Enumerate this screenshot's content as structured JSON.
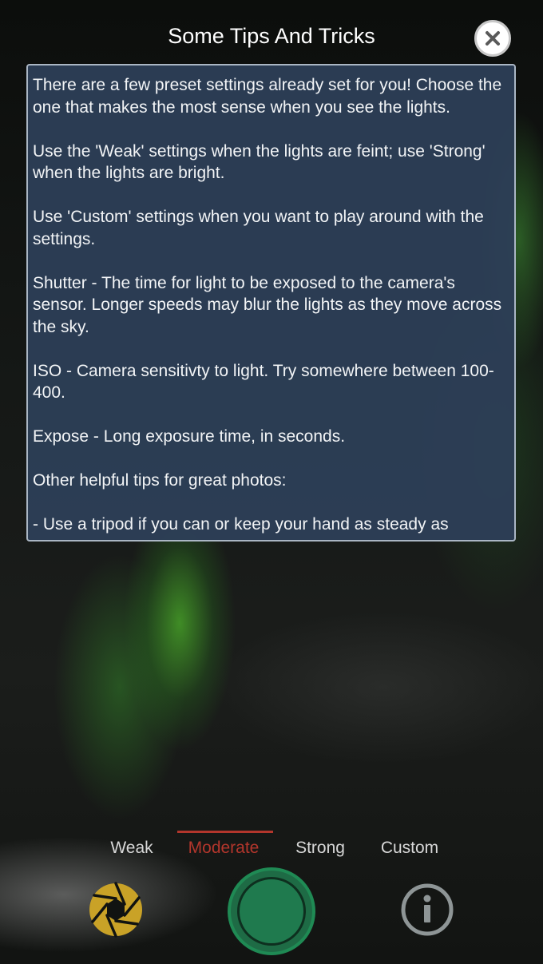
{
  "header": {
    "title": "Some Tips And Tricks"
  },
  "panel": {
    "paragraphs": [
      "There are a few preset settings already set for you! Choose the one that makes the most sense when you see the lights.",
      "Use the 'Weak' settings when the lights are feint; use 'Strong' when the lights are bright.",
      "Use 'Custom' settings when you want to play around with the settings.",
      "Shutter - The time for light to be exposed to the camera's sensor. Longer speeds may blur the lights as they move across the sky.",
      "ISO - Camera sensitivty to light. Try somewhere between 100-400.",
      "Expose - Long exposure time, in seconds.",
      "Other helpful tips for great photos:",
      "- Use a tripod if you can or keep your hand as steady as"
    ]
  },
  "tabs": [
    {
      "label": "Weak",
      "active": false
    },
    {
      "label": "Moderate",
      "active": true
    },
    {
      "label": "Strong",
      "active": false
    },
    {
      "label": "Custom",
      "active": false
    }
  ],
  "icons": {
    "close": "close-icon",
    "aperture": "aperture-icon",
    "shutter": "shutter-button",
    "info": "info-icon"
  },
  "colors": {
    "accent_active_tab": "#b3362c",
    "aperture": "#c9a227",
    "shutter": "#1f8a54",
    "panel_bg": "#2d3e56"
  }
}
